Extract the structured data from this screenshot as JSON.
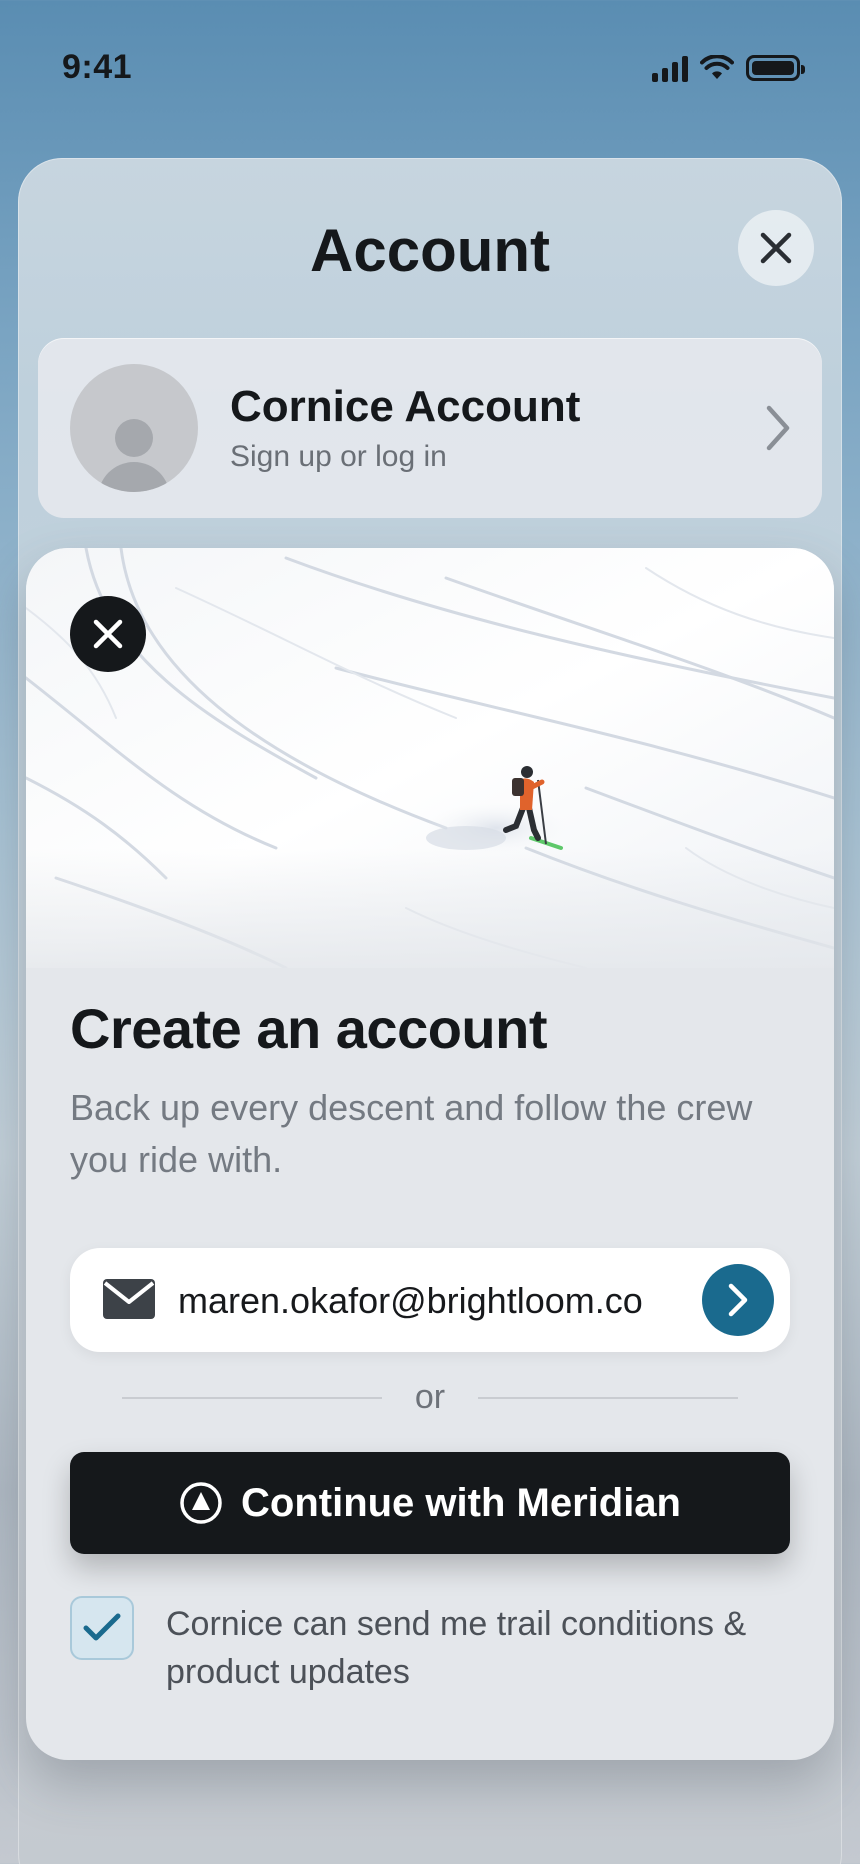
{
  "status_bar": {
    "time": "9:41"
  },
  "sheet": {
    "title": "Account",
    "account": {
      "name": "Cornice Account",
      "subtitle": "Sign up or log in"
    }
  },
  "signup": {
    "title": "Create an account",
    "description": "Back up every descent and follow the crew you ride with.",
    "email": {
      "value": "maren.okafor@brightloom.co"
    },
    "divider_text": "or",
    "sso_button": "Continue with Meridian",
    "consent": {
      "checked": true,
      "label": "Cornice can send me trail conditions & product updates"
    }
  },
  "colors": {
    "accent": "#1a6a8e",
    "primary_button": "#15181b",
    "hero_jacket": "#e0632c",
    "ski": "#5ec86a"
  },
  "icons": [
    "close-icon",
    "chevron-right-icon",
    "mail-icon",
    "arrow-right-icon",
    "meridian-logo-icon",
    "checkmark-icon"
  ]
}
